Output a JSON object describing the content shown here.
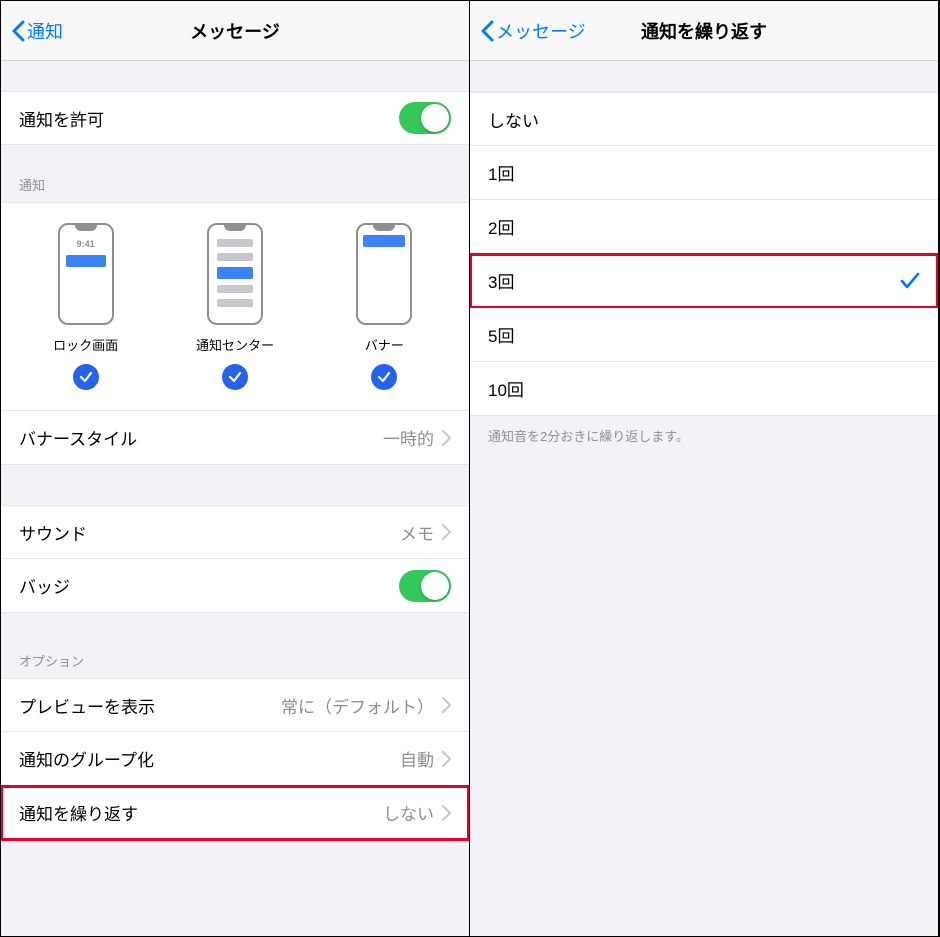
{
  "left": {
    "nav": {
      "back": "通知",
      "title": "メッセージ"
    },
    "allow": {
      "label": "通知を許可"
    },
    "alerts": {
      "header": "通知",
      "lock": {
        "label": "ロック画面",
        "time": "9:41"
      },
      "center": {
        "label": "通知センター"
      },
      "banner": {
        "label": "バナー"
      }
    },
    "bannerStyle": {
      "label": "バナースタイル",
      "value": "一時的"
    },
    "sound": {
      "label": "サウンド",
      "value": "メモ"
    },
    "badge": {
      "label": "バッジ"
    },
    "options": {
      "header": "オプション",
      "preview": {
        "label": "プレビューを表示",
        "value": "常に（デフォルト）"
      },
      "grouping": {
        "label": "通知のグループ化",
        "value": "自動"
      },
      "repeat": {
        "label": "通知を繰り返す",
        "value": "しない"
      }
    }
  },
  "right": {
    "nav": {
      "back": "メッセージ",
      "title": "通知を繰り返す"
    },
    "options": [
      {
        "label": "しない",
        "selected": false
      },
      {
        "label": "1回",
        "selected": false
      },
      {
        "label": "2回",
        "selected": false
      },
      {
        "label": "3回",
        "selected": true,
        "highlighted": true
      },
      {
        "label": "5回",
        "selected": false
      },
      {
        "label": "10回",
        "selected": false
      }
    ],
    "footer": "通知音を2分おきに繰り返します。"
  }
}
